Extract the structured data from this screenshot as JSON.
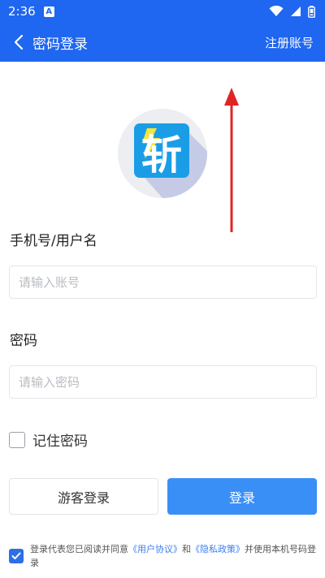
{
  "status_bar": {
    "time": "2:36",
    "notification_icon": "a-badge-icon"
  },
  "app_bar": {
    "title": "密码登录",
    "back_icon": "chevron-left-icon",
    "register_label": "注册账号",
    "background_color": "#1f66f0"
  },
  "logo": {
    "glyph": "斩",
    "tile_color": "#1a9de6",
    "bolt_color": "#f5e63a"
  },
  "account": {
    "label": "手机号/用户名",
    "placeholder": "请输入账号"
  },
  "password": {
    "label": "密码",
    "placeholder": "请输入密码"
  },
  "remember": {
    "label": "记住密码"
  },
  "buttons": {
    "guest_label": "游客登录",
    "login_label": "登录",
    "login_color": "#3a8ff7"
  },
  "agreement": {
    "prefix": "登录代表您已阅读并同意",
    "user_agreement": "《用户协议》",
    "and": "和",
    "privacy_policy": "《隐私政策》",
    "suffix": "并使用本机号码登录"
  }
}
